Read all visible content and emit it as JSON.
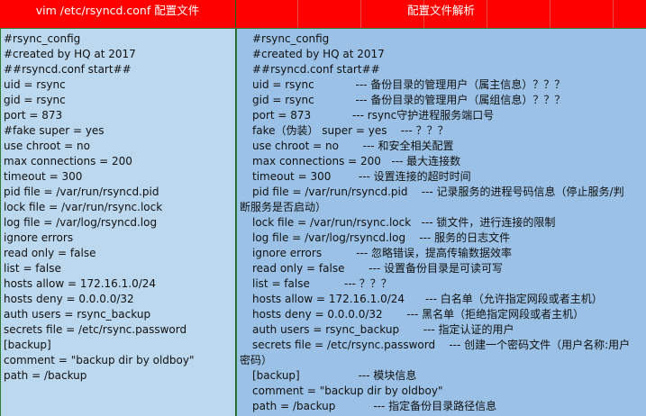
{
  "headers": {
    "left": "vim /etc/rsyncd.conf  配置文件",
    "right": "配置文件解析"
  },
  "left_lines": [
    "#rsync_config",
    "#created by HQ at 2017",
    "##rsyncd.conf start##",
    "uid = rsync",
    "gid = rsync",
    "port = 873",
    "#fake super = yes",
    "use chroot = no",
    "max connections = 200",
    "timeout = 300",
    "pid file = /var/run/rsyncd.pid",
    "lock file = /var/run/rsync.lock",
    "log file = /var/log/rsyncd.log",
    "ignore errors",
    "read only = false",
    "list = false",
    "hosts allow = 172.16.1.0/24",
    "hosts deny = 0.0.0.0/32",
    "auth users = rsync_backup",
    "secrets file = /etc/rsync.password",
    "[backup]",
    "comment = \"backup dir by oldboy\"",
    "path = /backup"
  ],
  "right_lines": [
    "#rsync_config",
    "#created by HQ at 2017",
    "##rsyncd.conf start##",
    "uid = rsync            --- 备份目录的管理用户（属主信息）？？？",
    "gid = rsync            --- 备份目录的管理用户（属组信息）？？？",
    "port = 873            --- rsync守护进程服务端口号",
    "fake（伪装） super = yes    --- ？？？",
    "use chroot = no       --- 和安全相关配置",
    "max connections = 200   --- 最大连接数",
    "timeout = 300        --- 设置连接的超时时间",
    "pid file = /var/run/rsyncd.pid    --- 记录服务的进程号码信息（停止服务/判",
    "断服务是否启动）",
    "lock file = /var/run/rsync.lock   --- 锁文件，进行连接的限制",
    "log file = /var/log/rsyncd.log    --- 服务的日志文件",
    "ignore errors          --- 忽略错误，提高传输数据效率",
    "read only = false       --- 设置备份目录是可读可写",
    "list = false          --- ？？？",
    "hosts allow = 172.16.1.0/24      --- 白名单（允许指定网段或者主机）",
    "hosts deny = 0.0.0.0/32       --- 黑名单（拒绝指定网段或者主机）",
    "auth users = rsync_backup       --- 指定认证的用户",
    "secrets file = /etc/rsync.password    --- 创建一个密码文件（用户名称:用户",
    "密码）",
    "[backup]                 --- 模块信息",
    "comment = \"backup dir by oldboy\"",
    "path = /backup           --- 指定备份目录路径信息"
  ]
}
